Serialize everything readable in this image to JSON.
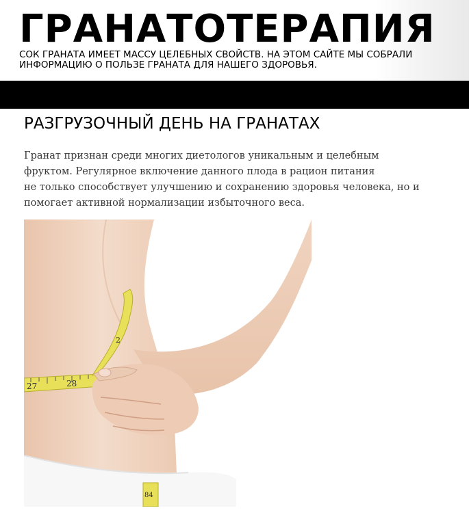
{
  "header": {
    "site_title": "ГРАНАТОТЕРАПИЯ",
    "tagline": "СОК ГРАНАТА ИМЕЕТ МАССУ ЦЕЛЕБНЫХ СВОЙСТВ. НА ЭТОМ САЙТЕ МЫ СОБРАЛИ ИНФОРМАЦИЮ О ПОЛЬЗЕ ГРАНАТА ДЛЯ НАШЕГО ЗДОРОВЬЯ."
  },
  "article": {
    "title": "РАЗГРУЗОЧНЫЙ ДЕНЬ НА ГРАНАТАХ",
    "paragraph_lines": [
      "Гранат признан среди многих диетологов уникальным и целебным",
      "фруктом. Регулярное включение данного плода в рацион питания",
      "не только способствует улучшению и сохранению здоровья человека, но и",
      "помогает активной нормализации избыточного веса."
    ],
    "image": {
      "tape_numbers": [
        "27",
        "28",
        "2",
        "84"
      ]
    }
  },
  "colors": {
    "nav_bar": "#000000",
    "skin": "#efd2bd",
    "tape": "#e9e05a",
    "text": "#3a3a3a"
  }
}
